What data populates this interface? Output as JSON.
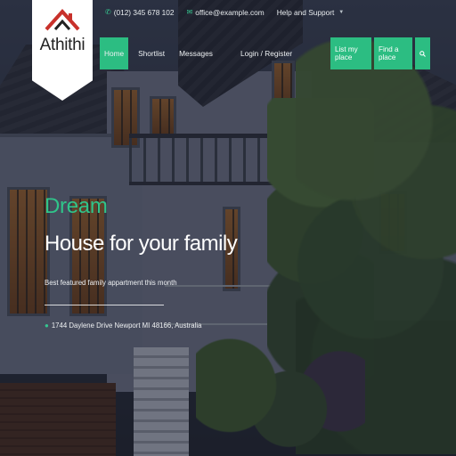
{
  "brand": {
    "name": "Athithi",
    "logo_icon": "house-roof-icon"
  },
  "topbar": {
    "phone": "(012) 345 678 102",
    "email": "office@example.com",
    "help_label": "Help and Support",
    "phone_icon": "phone-icon",
    "email_icon": "mail-icon",
    "accent_color": "#35c58f"
  },
  "nav": {
    "items": [
      {
        "label": "Home",
        "active": true
      },
      {
        "label": "Shortlist",
        "active": false
      },
      {
        "label": "Messages",
        "active": false
      }
    ],
    "login_label": "Login / Register",
    "list_place_label": "List my place",
    "find_place_label": "Find a place",
    "search_icon": "search-icon",
    "button_color": "#2cbd82"
  },
  "hero": {
    "eyebrow": "Dream",
    "title": "House for your family",
    "subtitle": "Best featured family appartment this month",
    "address": "1744 Daylene Drive Newport MI 48166, Australia",
    "address_icon": "map-pin-icon",
    "eyebrow_color": "#30c48a"
  }
}
